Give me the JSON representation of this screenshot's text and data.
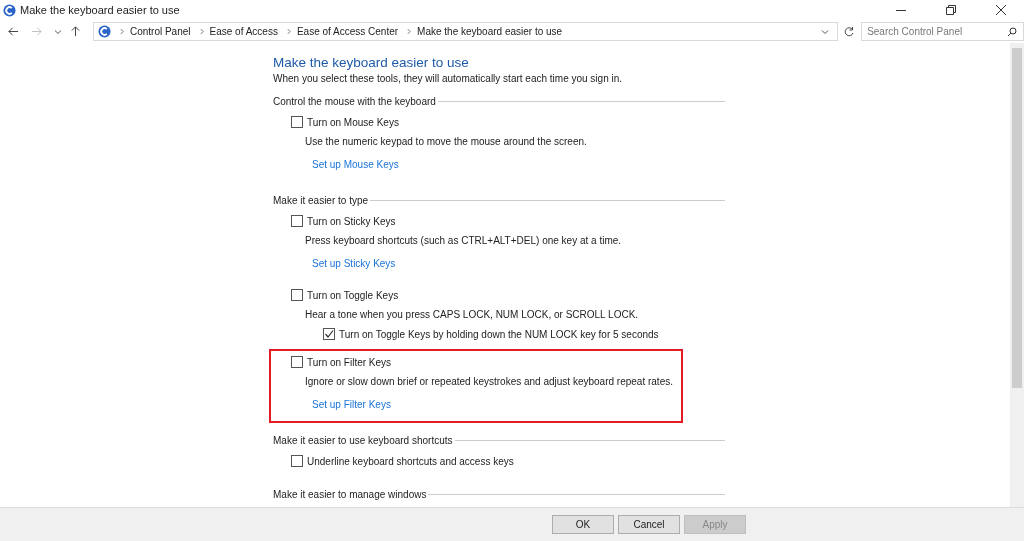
{
  "window": {
    "title": "Make the keyboard easier to use"
  },
  "address_bar": {
    "breadcrumbs": [
      "Control Panel",
      "Ease of Access",
      "Ease of Access Center",
      "Make the keyboard easier to use"
    ],
    "search": {
      "placeholder": "Search Control Panel"
    }
  },
  "page": {
    "title": "Make the keyboard easier to use",
    "subtitle": "When you select these tools, they will automatically start each time you sign in.",
    "sections": [
      {
        "heading": "Control the mouse with the keyboard",
        "groups": [
          {
            "highlighted": false,
            "items": [
              {
                "kind": "checkbox",
                "label": "Turn on Mouse Keys",
                "checked": false
              },
              {
                "kind": "text",
                "text": "Use the numeric keypad to move the mouse around the screen."
              },
              {
                "kind": "link",
                "text": "Set up Mouse Keys"
              }
            ]
          }
        ]
      },
      {
        "heading": "Make it easier to type",
        "groups": [
          {
            "highlighted": false,
            "items": [
              {
                "kind": "checkbox",
                "label": "Turn on Sticky Keys",
                "checked": false
              },
              {
                "kind": "text",
                "text": "Press keyboard shortcuts (such as CTRL+ALT+DEL) one key at a time."
              },
              {
                "kind": "link",
                "text": "Set up Sticky Keys"
              }
            ]
          },
          {
            "highlighted": false,
            "items": [
              {
                "kind": "checkbox",
                "label": "Turn on Toggle Keys",
                "checked": false
              },
              {
                "kind": "text",
                "text": "Hear a tone when you press CAPS LOCK, NUM LOCK, or SCROLL LOCK."
              },
              {
                "kind": "subcheckbox",
                "label": "Turn on Toggle Keys by holding down the NUM LOCK key for 5 seconds",
                "checked": true
              }
            ]
          },
          {
            "highlighted": true,
            "items": [
              {
                "kind": "checkbox",
                "label": "Turn on Filter Keys",
                "checked": false
              },
              {
                "kind": "text",
                "text": "Ignore or slow down brief or repeated keystrokes and adjust keyboard repeat rates."
              },
              {
                "kind": "link",
                "text": "Set up Filter Keys"
              }
            ]
          }
        ]
      },
      {
        "heading": "Make it easier to use keyboard shortcuts",
        "groups": [
          {
            "highlighted": false,
            "items": [
              {
                "kind": "checkbox",
                "label": "Underline keyboard shortcuts and access keys",
                "checked": false
              }
            ]
          }
        ]
      },
      {
        "heading": "Make it easier to manage windows"
      }
    ]
  },
  "buttons": [
    {
      "label": "OK",
      "disabled": false
    },
    {
      "label": "Cancel",
      "disabled": false
    },
    {
      "label": "Apply",
      "disabled": true
    }
  ]
}
